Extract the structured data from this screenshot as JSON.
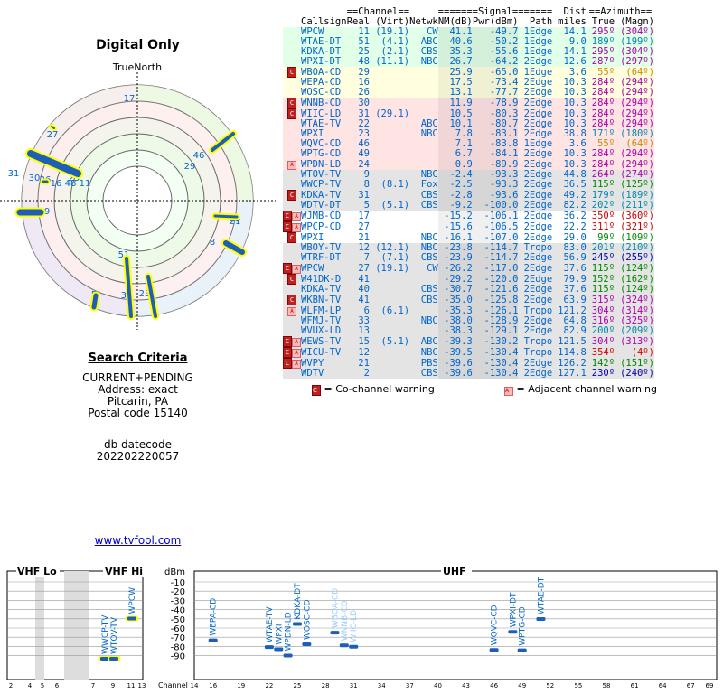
{
  "header": {
    "title": "Digital Only",
    "compass_label": "TrueNorth"
  },
  "compass": {
    "north": "N",
    "labels": [
      "17",
      "27",
      "46",
      "29",
      "23",
      "31",
      "30",
      "26",
      "16",
      "48",
      "25",
      "11",
      "9",
      "21",
      "8",
      "51",
      "23",
      "5",
      "31"
    ]
  },
  "search": {
    "title": "Search Criteria",
    "lines": [
      "CURRENT+PENDING",
      "Address: exact",
      "Pitcarin, PA",
      "Postal code 15140"
    ],
    "datecode_label": "db datecode",
    "datecode": "202202220057",
    "link": "www.tvfool.com"
  },
  "table": {
    "group_headers": {
      "channel": "==Channel==",
      "signal": "=======Signal=======",
      "dist": "Dist",
      "azimuth": "==Azimuth=="
    },
    "headers": [
      "Callsign",
      "Real",
      "(Virt)",
      "Netwk",
      "NM(dB)",
      "Pwr(dBm)",
      "Path",
      "miles",
      "True",
      "(Magn)"
    ],
    "rows": [
      {
        "warn": "",
        "callsign": "WPCW",
        "real": "11",
        "virt": "(19.1)",
        "netwk": "CW",
        "nm": "41.1",
        "pwr": "-49.7",
        "path": "1Edge",
        "miles": "14.1",
        "true": "295º",
        "magn": "(304º)",
        "bg": "#e2ffe8",
        "color": "#06c",
        "azc": "#a0a"
      },
      {
        "warn": "",
        "callsign": "WTAE-DT",
        "real": "51",
        "virt": "(4.1)",
        "netwk": "ABC",
        "nm": "40.6",
        "pwr": "-50.2",
        "path": "1Edge",
        "miles": "9.0",
        "true": "189º",
        "magn": "(199º)",
        "bg": "#e2ffe8",
        "color": "#06c",
        "azc": "#08a"
      },
      {
        "warn": "",
        "callsign": "KDKA-DT",
        "real": "25",
        "virt": "(2.1)",
        "netwk": "CBS",
        "nm": "35.3",
        "pwr": "-55.6",
        "path": "1Edge",
        "miles": "14.1",
        "true": "295º",
        "magn": "(304º)",
        "bg": "#e2ffe8",
        "color": "#06c",
        "azc": "#a0a"
      },
      {
        "warn": "",
        "callsign": "WPXI-DT",
        "real": "48",
        "virt": "(11.1)",
        "netwk": "NBC",
        "nm": "26.7",
        "pwr": "-64.2",
        "path": "2Edge",
        "miles": "12.6",
        "true": "287º",
        "magn": "(297º)",
        "bg": "#e2ffe8",
        "color": "#06c",
        "azc": "#a0a"
      },
      {
        "warn": "C",
        "callsign": "WBOA-CD",
        "real": "29",
        "virt": "",
        "netwk": "",
        "nm": "25.9",
        "pwr": "-65.0",
        "path": "1Edge",
        "miles": "3.6",
        "true": "55º",
        "magn": "(64º)",
        "bg": "#ffffe0",
        "color": "#06c",
        "azc": "#c80"
      },
      {
        "warn": "",
        "callsign": "WEPA-CD",
        "real": "16",
        "virt": "",
        "netwk": "",
        "nm": "17.5",
        "pwr": "-73.4",
        "path": "2Edge",
        "miles": "10.3",
        "true": "284º",
        "magn": "(294º)",
        "bg": "#ffffe0",
        "color": "#06c",
        "azc": "#a0a"
      },
      {
        "warn": "",
        "callsign": "WOSC-CD",
        "real": "26",
        "virt": "",
        "netwk": "",
        "nm": "13.1",
        "pwr": "-77.7",
        "path": "2Edge",
        "miles": "10.3",
        "true": "284º",
        "magn": "(294º)",
        "bg": "#ffffe0",
        "color": "#06c",
        "azc": "#a0a"
      },
      {
        "warn": "C",
        "callsign": "WNNB-CD",
        "real": "30",
        "virt": "",
        "netwk": "",
        "nm": "11.9",
        "pwr": "-78.9",
        "path": "2Edge",
        "miles": "10.3",
        "true": "284º",
        "magn": "(294º)",
        "bg": "#ffe4e4",
        "color": "#06c",
        "azc": "#a0a"
      },
      {
        "warn": "C",
        "callsign": "WIIC-LD",
        "real": "31",
        "virt": "(29.1)",
        "netwk": "",
        "nm": "10.5",
        "pwr": "-80.3",
        "path": "2Edge",
        "miles": "10.3",
        "true": "284º",
        "magn": "(294º)",
        "bg": "#ffe4e4",
        "color": "#06c",
        "azc": "#a0a"
      },
      {
        "warn": "",
        "callsign": "WTAE-TV",
        "real": "22",
        "virt": "",
        "netwk": "ABC",
        "nm": "10.1",
        "pwr": "-80.7",
        "path": "2Edge",
        "miles": "10.3",
        "true": "284º",
        "magn": "(294º)",
        "bg": "#ffe4e4",
        "color": "#06c",
        "azc": "#a0a"
      },
      {
        "warn": "",
        "callsign": "WPXI",
        "real": "23",
        "virt": "",
        "netwk": "NBC",
        "nm": "7.8",
        "pwr": "-83.1",
        "path": "2Edge",
        "miles": "38.8",
        "true": "171º",
        "magn": "(180º)",
        "bg": "#ffe4e4",
        "color": "#06c",
        "azc": "#08a"
      },
      {
        "warn": "",
        "callsign": "WQVC-CD",
        "real": "46",
        "virt": "",
        "netwk": "",
        "nm": "7.1",
        "pwr": "-83.8",
        "path": "1Edge",
        "miles": "3.6",
        "true": "55º",
        "magn": "(64º)",
        "bg": "#ffe4e4",
        "color": "#06c",
        "azc": "#c80"
      },
      {
        "warn": "",
        "callsign": "WPTG-CD",
        "real": "49",
        "virt": "",
        "netwk": "",
        "nm": "6.7",
        "pwr": "-84.1",
        "path": "2Edge",
        "miles": "10.3",
        "true": "284º",
        "magn": "(294º)",
        "bg": "#ffe4e4",
        "color": "#06c",
        "azc": "#a0a"
      },
      {
        "warn": "A",
        "callsign": "WPDN-LD",
        "real": "24",
        "virt": "",
        "netwk": "",
        "nm": "0.9",
        "pwr": "-89.9",
        "path": "2Edge",
        "miles": "10.3",
        "true": "284º",
        "magn": "(294º)",
        "bg": "#ffe4e4",
        "color": "#06c",
        "azc": "#a0a"
      },
      {
        "warn": "",
        "callsign": "WTOV-TV",
        "real": "9",
        "virt": "",
        "netwk": "NBC",
        "nm": "-2.4",
        "pwr": "-93.3",
        "path": "2Edge",
        "miles": "44.8",
        "true": "264º",
        "magn": "(274º)",
        "bg": "#e4e4e4",
        "color": "#06c",
        "azc": "#a0a"
      },
      {
        "warn": "",
        "callsign": "WWCP-TV",
        "real": "8",
        "virt": "(8.1)",
        "netwk": "Fox",
        "nm": "-2.5",
        "pwr": "-93.3",
        "path": "2Edge",
        "miles": "36.5",
        "true": "115º",
        "magn": "(125º)",
        "bg": "#e4e4e4",
        "color": "#06c",
        "azc": "#080"
      },
      {
        "warn": "C",
        "callsign": "KDKA-TV",
        "real": "31",
        "virt": "",
        "netwk": "CBS",
        "nm": "-2.8",
        "pwr": "-93.6",
        "path": "2Edge",
        "miles": "49.2",
        "true": "179º",
        "magn": "(189º)",
        "bg": "#e4e4e4",
        "color": "#06c",
        "azc": "#08a"
      },
      {
        "warn": "",
        "callsign": "WDTV-DT",
        "real": "5",
        "virt": "(5.1)",
        "netwk": "CBS",
        "nm": "-9.2",
        "pwr": "-100.0",
        "path": "2Edge",
        "miles": "82.2",
        "true": "202º",
        "magn": "(211º)",
        "bg": "#e4e4e4",
        "color": "#06c",
        "azc": "#08a"
      },
      {
        "warn": "CA",
        "callsign": "WJMB-CD",
        "real": "17",
        "virt": "",
        "netwk": "",
        "nm": "-15.2",
        "pwr": "-106.1",
        "path": "2Edge",
        "miles": "36.2",
        "true": "350º",
        "magn": "(360º)",
        "bg": "#fff",
        "color": "#06c",
        "azc": "#c00"
      },
      {
        "warn": "CA",
        "callsign": "WPCP-CD",
        "real": "27",
        "virt": "",
        "netwk": "",
        "nm": "-15.6",
        "pwr": "-106.5",
        "path": "2Edge",
        "miles": "22.2",
        "true": "311º",
        "magn": "(321º)",
        "bg": "#fff",
        "color": "#06c",
        "azc": "#c00"
      },
      {
        "warn": "C",
        "callsign": "WPXI",
        "real": "21",
        "virt": "",
        "netwk": "NBC",
        "nm": "-16.1",
        "pwr": "-107.0",
        "path": "2Edge",
        "miles": "29.0",
        "true": "99º",
        "magn": "(109º)",
        "bg": "#fff",
        "color": "#06c",
        "azc": "#080"
      },
      {
        "warn": "",
        "callsign": "WBOY-TV",
        "real": "12",
        "virt": "(12.1)",
        "netwk": "NBC",
        "nm": "-23.8",
        "pwr": "-114.7",
        "path": "Tropo",
        "miles": "83.0",
        "true": "201º",
        "magn": "(210º)",
        "bg": "#e4e4e4",
        "color": "#06c",
        "azc": "#08a"
      },
      {
        "warn": "",
        "callsign": "WTRF-DT",
        "real": "7",
        "virt": "(7.1)",
        "netwk": "CBS",
        "nm": "-23.9",
        "pwr": "-114.7",
        "path": "2Edge",
        "miles": "56.9",
        "true": "245º",
        "magn": "(255º)",
        "bg": "#e4e4e4",
        "color": "#06c",
        "azc": "#00a"
      },
      {
        "warn": "CA",
        "callsign": "WPCW",
        "real": "27",
        "virt": "(19.1)",
        "netwk": "CW",
        "nm": "-26.2",
        "pwr": "-117.0",
        "path": "2Edge",
        "miles": "37.6",
        "true": "115º",
        "magn": "(124º)",
        "bg": "#e4e4e4",
        "color": "#06c",
        "azc": "#080"
      },
      {
        "warn": "C",
        "callsign": "W41DK-D",
        "real": "41",
        "virt": "",
        "netwk": "",
        "nm": "-29.2",
        "pwr": "-120.0",
        "path": "2Edge",
        "miles": "79.9",
        "true": "152º",
        "magn": "(162º)",
        "bg": "#e4e4e4",
        "color": "#06c",
        "azc": "#080"
      },
      {
        "warn": "",
        "callsign": "KDKA-TV",
        "real": "40",
        "virt": "",
        "netwk": "CBS",
        "nm": "-30.7",
        "pwr": "-121.6",
        "path": "2Edge",
        "miles": "37.6",
        "true": "115º",
        "magn": "(124º)",
        "bg": "#e4e4e4",
        "color": "#06c",
        "azc": "#080"
      },
      {
        "warn": "C",
        "callsign": "WKBN-TV",
        "real": "41",
        "virt": "",
        "netwk": "CBS",
        "nm": "-35.0",
        "pwr": "-125.8",
        "path": "2Edge",
        "miles": "63.9",
        "true": "315º",
        "magn": "(324º)",
        "bg": "#e4e4e4",
        "color": "#06c",
        "azc": "#a0a"
      },
      {
        "warn": "A",
        "callsign": "WLFM-LP",
        "real": "6",
        "virt": "(6.1)",
        "netwk": "",
        "nm": "-35.3",
        "pwr": "-126.1",
        "path": "Tropo",
        "miles": "121.2",
        "true": "304º",
        "magn": "(314º)",
        "bg": "#e4e4e4",
        "color": "#06c",
        "azc": "#a0a"
      },
      {
        "warn": "",
        "callsign": "WFMJ-TV",
        "real": "33",
        "virt": "",
        "netwk": "NBC",
        "nm": "-38.0",
        "pwr": "-128.9",
        "path": "2Edge",
        "miles": "64.8",
        "true": "316º",
        "magn": "(325º)",
        "bg": "#e4e4e4",
        "color": "#06c",
        "azc": "#a0a"
      },
      {
        "warn": "",
        "callsign": "WVUX-LD",
        "real": "13",
        "virt": "",
        "netwk": "",
        "nm": "-38.3",
        "pwr": "-129.1",
        "path": "2Edge",
        "miles": "82.9",
        "true": "200º",
        "magn": "(209º)",
        "bg": "#e4e4e4",
        "color": "#06c",
        "azc": "#08a"
      },
      {
        "warn": "CA",
        "callsign": "WEWS-TV",
        "real": "15",
        "virt": "(5.1)",
        "netwk": "ABC",
        "nm": "-39.3",
        "pwr": "-130.2",
        "path": "Tropo",
        "miles": "121.5",
        "true": "304º",
        "magn": "(313º)",
        "bg": "#e4e4e4",
        "color": "#06c",
        "azc": "#a0a"
      },
      {
        "warn": "CA",
        "callsign": "WICU-TV",
        "real": "12",
        "virt": "",
        "netwk": "NBC",
        "nm": "-39.5",
        "pwr": "-130.4",
        "path": "Tropo",
        "miles": "114.8",
        "true": "354º",
        "magn": "(4º)",
        "bg": "#e4e4e4",
        "color": "#06c",
        "azc": "#c00"
      },
      {
        "warn": "CA",
        "callsign": "WVPY",
        "real": "21",
        "virt": "",
        "netwk": "PBS",
        "nm": "-39.6",
        "pwr": "-130.4",
        "path": "2Edge",
        "miles": "126.2",
        "true": "142º",
        "magn": "(151º)",
        "bg": "#e4e4e4",
        "color": "#06c",
        "azc": "#080"
      },
      {
        "warn": "",
        "callsign": "WDTV",
        "real": "2",
        "virt": "",
        "netwk": "CBS",
        "nm": "-39.6",
        "pwr": "-130.4",
        "path": "2Edge",
        "miles": "127.1",
        "true": "230º",
        "magn": "(240º)",
        "bg": "#e4e4e4",
        "color": "#06c",
        "azc": "#00a"
      }
    ],
    "legend": {
      "cochannel": "= Co-channel warning",
      "adjacent": "= Adjacent channel warning",
      "c_glyph": "C",
      "a_glyph": "A"
    }
  },
  "spectrum": {
    "vhf_lo": "VHF Lo",
    "vhf_hi": "VHF Hi",
    "uhf": "UHF",
    "dbm_label": "dBm",
    "channel_label": "Channel",
    "y_ticks": [
      "-10",
      "-20",
      "-30",
      "-40",
      "-50",
      "-60",
      "-70",
      "-80",
      "-90"
    ],
    "vhf_ticks": [
      "2",
      "4",
      "5",
      "6",
      "7",
      "9",
      "11",
      "13"
    ],
    "uhf_ticks": [
      "14",
      "16",
      "19",
      "22",
      "25",
      "28",
      "31",
      "34",
      "37",
      "40",
      "43",
      "46",
      "49",
      "52",
      "55",
      "58",
      "61",
      "64",
      "67",
      "69"
    ],
    "stations": [
      {
        "label": "WWCP-TV",
        "ch": 8,
        "dbm": -93.3
      },
      {
        "label": "WTOV-TV",
        "ch": 9,
        "dbm": -93.3
      },
      {
        "label": "WPCW",
        "ch": 11,
        "dbm": -49.7
      },
      {
        "label": "WEPA-CD",
        "ch": 16,
        "dbm": -73.4
      },
      {
        "label": "WTAE-TV",
        "ch": 22,
        "dbm": -80.7
      },
      {
        "label": "WPXI",
        "ch": 23,
        "dbm": -83.1
      },
      {
        "label": "WPDN-LD",
        "ch": 24,
        "dbm": -89.9
      },
      {
        "label": "KDKA-DT",
        "ch": 25,
        "dbm": -55.6
      },
      {
        "label": "WOSC-CD",
        "ch": 26,
        "dbm": -77.7
      },
      {
        "label": "WBOA-CD",
        "ch": 29,
        "dbm": -65.0
      },
      {
        "label": "WNNB-CD",
        "ch": 30,
        "dbm": -78.9
      },
      {
        "label": "WIIC-LD",
        "ch": 31,
        "dbm": -80.3
      },
      {
        "label": "WQVC-CD",
        "ch": 46,
        "dbm": -83.8
      },
      {
        "label": "WPXI-DT",
        "ch": 48,
        "dbm": -64.2
      },
      {
        "label": "WPTG-CD",
        "ch": 49,
        "dbm": -84.1
      },
      {
        "label": "WTAE-DT",
        "ch": 51,
        "dbm": -50.2
      }
    ]
  }
}
